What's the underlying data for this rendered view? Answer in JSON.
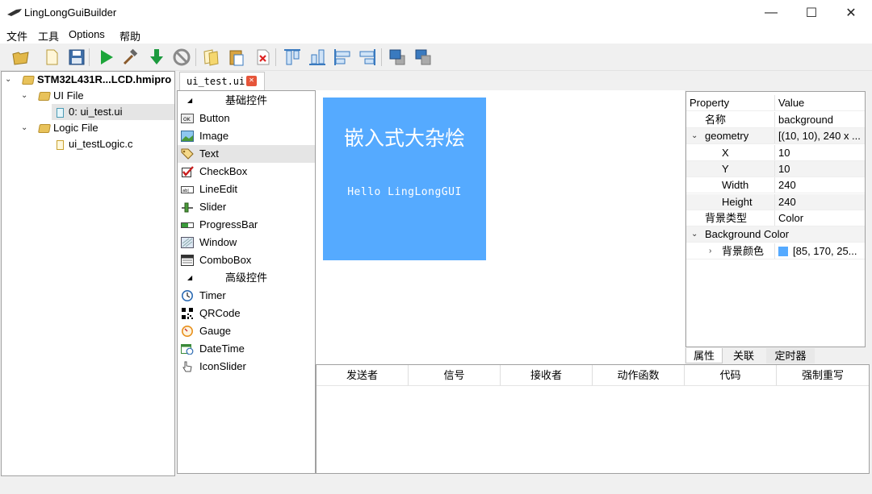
{
  "window": {
    "title": "LingLongGuiBuilder",
    "minimize": "—",
    "maximize": "☐",
    "close": "✕"
  },
  "menu": [
    "文件",
    "工具",
    "Options",
    "帮助"
  ],
  "toolbar": {
    "icons": [
      "open-folder-icon",
      "new-file-icon",
      "save-icon",
      "run-icon",
      "build-hammer-icon",
      "download-icon",
      "stop-icon",
      "copy-icon",
      "paste-icon",
      "delete-icon",
      "align-top-icon",
      "align-bottom-icon",
      "align-left-icon",
      "align-right-icon",
      "bring-front-icon",
      "send-back-icon"
    ]
  },
  "project": {
    "root": "STM32L431R...LCD.hmipro",
    "ui_folder": "UI File",
    "ui_file": "0: ui_test.ui",
    "logic_folder": "Logic File",
    "logic_file": "ui_testLogic.c"
  },
  "tab": {
    "label": "ui_test.ui",
    "close": "✕"
  },
  "widgets": {
    "basic_header": "基础控件",
    "advanced_header": "高级控件",
    "basic": [
      "Button",
      "Image",
      "Text",
      "CheckBox",
      "LineEdit",
      "Slider",
      "ProgressBar",
      "Window",
      "ComboBox"
    ],
    "advanced": [
      "Timer",
      "QRCode",
      "Gauge",
      "DateTime",
      "IconSlider"
    ],
    "selected": "Text"
  },
  "preview": {
    "title": "嵌入式大杂烩",
    "hello": "Hello LingLongGUI",
    "bg_color": "#55aaff"
  },
  "properties": {
    "header_property": "Property",
    "header_value": "Value",
    "rows": [
      {
        "name": "名称",
        "value": "background"
      },
      {
        "name": "geometry",
        "value": "[(10, 10), 240 x ..."
      },
      {
        "name": "X",
        "value": "10"
      },
      {
        "name": "Y",
        "value": "10"
      },
      {
        "name": "Width",
        "value": "240"
      },
      {
        "name": "Height",
        "value": "240"
      },
      {
        "name": "背景类型",
        "value": "Color"
      },
      {
        "name": "Background Color",
        "value": ""
      },
      {
        "name": "背景颜色",
        "value": "[85, 170, 25..."
      }
    ],
    "tabs": [
      "属性",
      "关联",
      "定时器"
    ]
  },
  "connections": {
    "columns": [
      "发送者",
      "信号",
      "接收者",
      "动作函数",
      "代码",
      "强制重写"
    ]
  }
}
